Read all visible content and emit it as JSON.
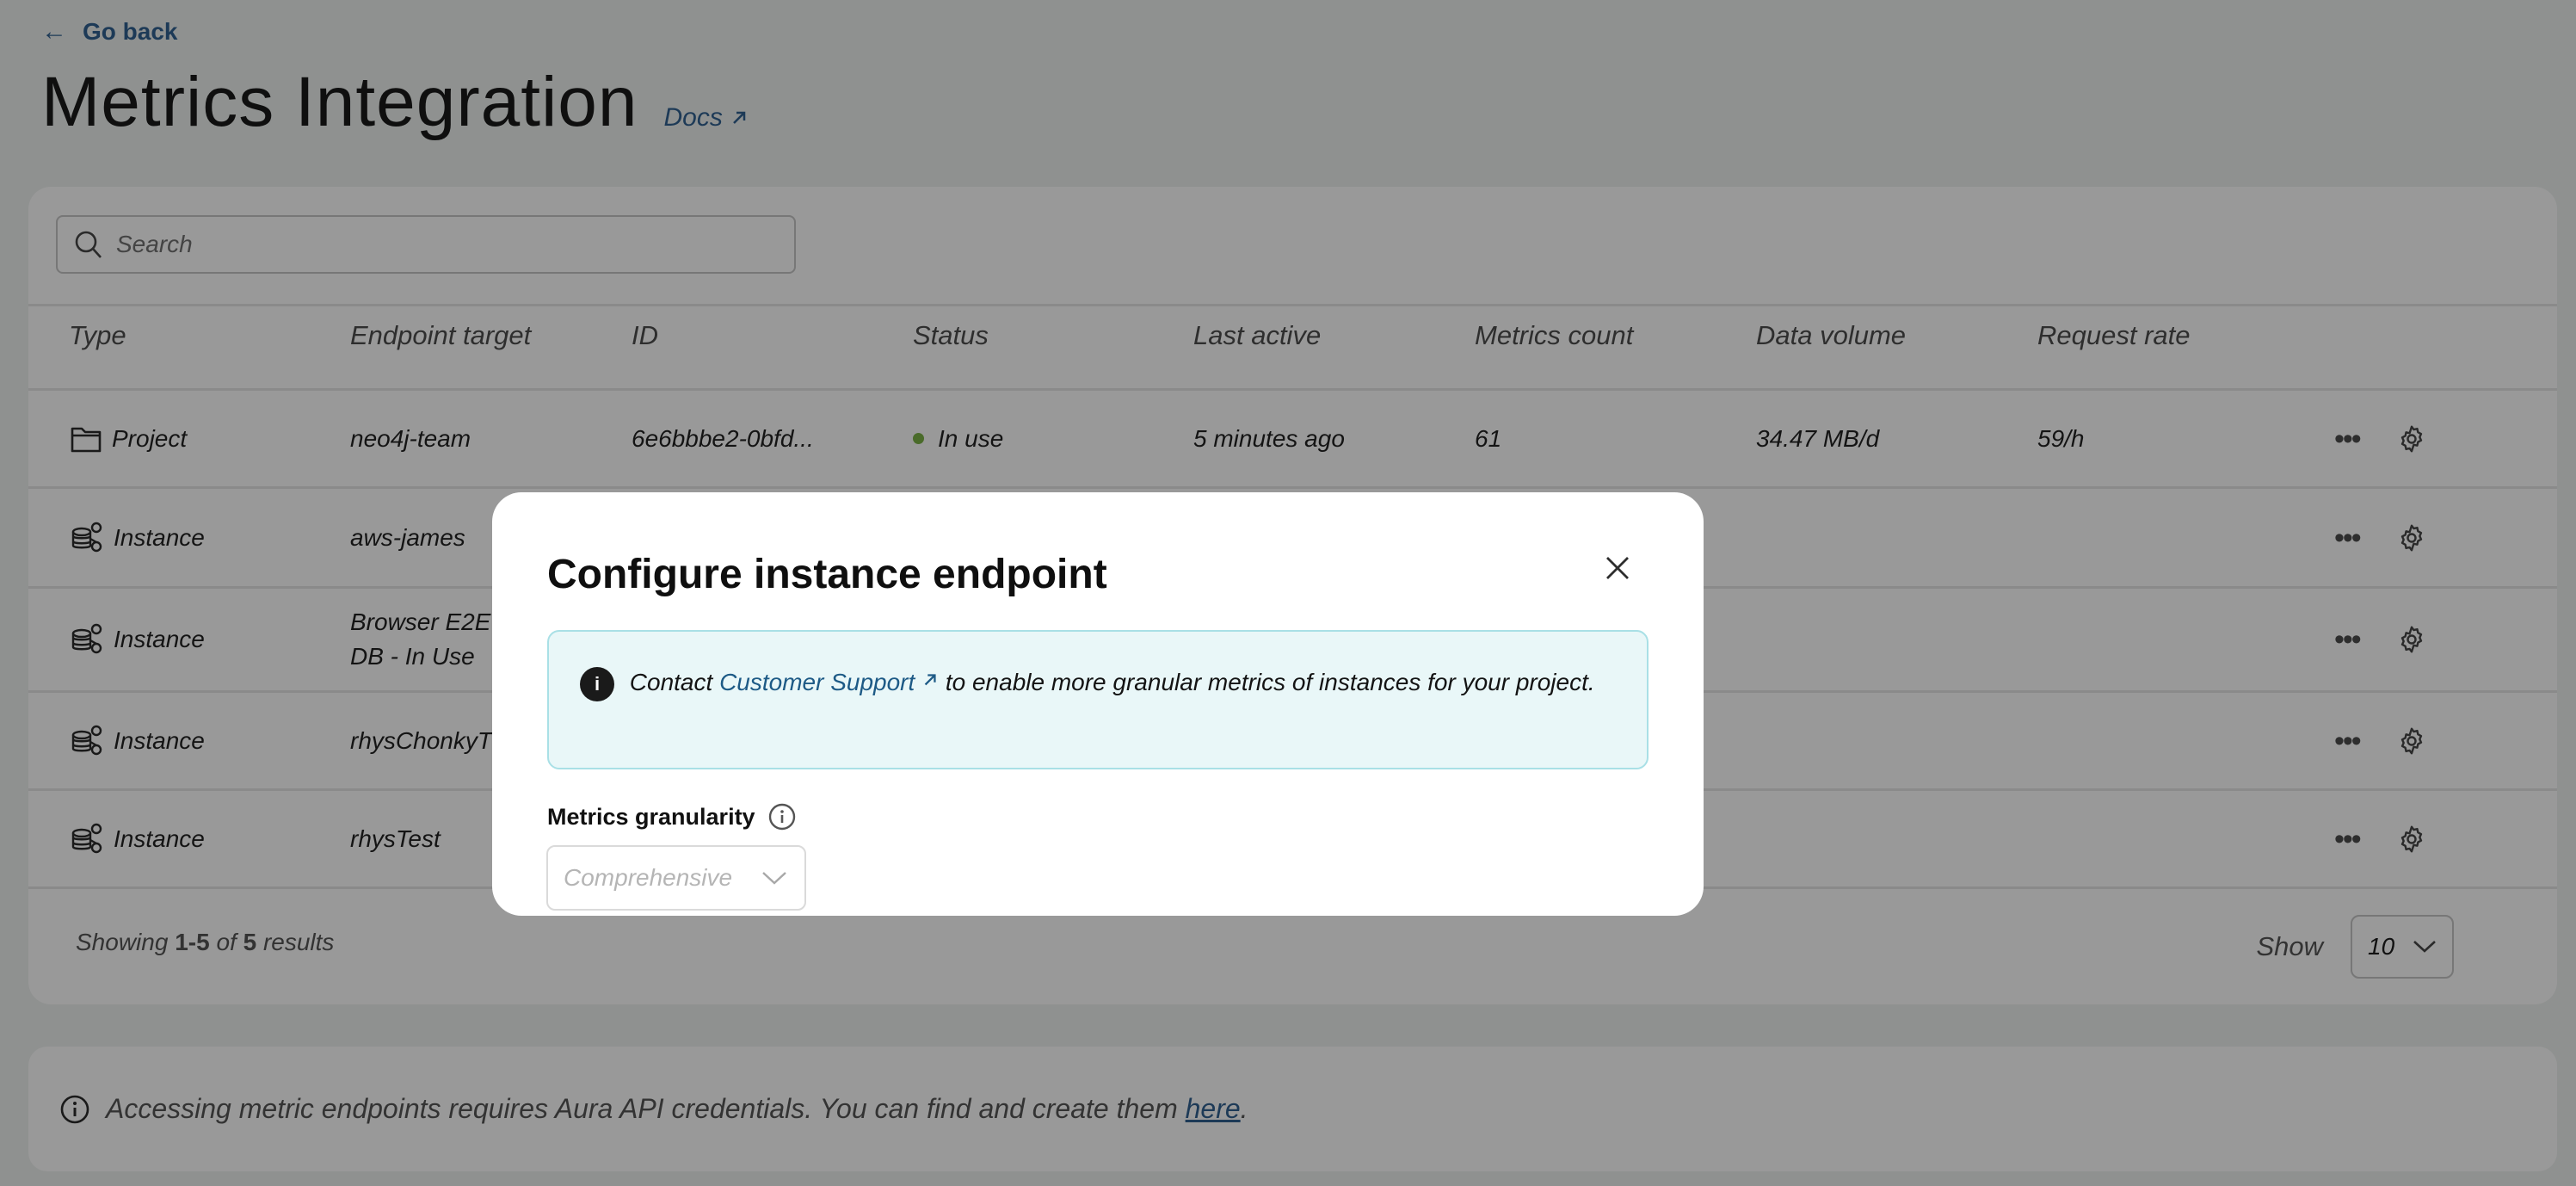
{
  "header": {
    "go_back_label": "Go back",
    "title": "Metrics Integration",
    "docs_label": "Docs"
  },
  "search": {
    "placeholder": "Search",
    "value": ""
  },
  "table": {
    "columns": [
      "Type",
      "Endpoint target",
      "ID",
      "Status",
      "Last active",
      "Metrics count",
      "Data volume",
      "Request rate"
    ],
    "rows": [
      {
        "type": "Project",
        "type_icon": "folder-icon",
        "endpoint_line1": "neo4j-team",
        "endpoint_line2": "",
        "id": "6e6bbbe2-0bfd...",
        "status": "In use",
        "status_color": "#4a6b2a",
        "last_active": "5 minutes ago",
        "metrics_count": "61",
        "data_volume": "34.47 MB/d",
        "request_rate": "59/h"
      },
      {
        "type": "Instance",
        "type_icon": "instances-icon",
        "endpoint_line1": "aws-james",
        "endpoint_line2": "",
        "id": "",
        "status": "",
        "last_active": "",
        "metrics_count": "",
        "data_volume": "",
        "request_rate": ""
      },
      {
        "type": "Instance",
        "type_icon": "instances-icon",
        "endpoint_line1": "Browser E2E",
        "endpoint_line2": "DB - In Use",
        "id": "",
        "status": "",
        "last_active": "",
        "metrics_count": "",
        "data_volume": "",
        "request_rate": ""
      },
      {
        "type": "Instance",
        "type_icon": "instances-icon",
        "endpoint_line1": "rhysChonkyT",
        "endpoint_line2": "",
        "id": "",
        "status": "",
        "last_active": "",
        "metrics_count": "",
        "data_volume": "",
        "request_rate": ""
      },
      {
        "type": "Instance",
        "type_icon": "instances-icon",
        "endpoint_line1": "rhysTest",
        "endpoint_line2": "",
        "id": "",
        "status": "",
        "last_active": "",
        "metrics_count": "",
        "data_volume": "",
        "request_rate": ""
      }
    ]
  },
  "pagination": {
    "showing_prefix": "Showing",
    "range": "1-5",
    "of_label": "of",
    "total": "5",
    "results_label": "results",
    "show_label": "Show",
    "page_size": "10"
  },
  "notice": {
    "text": "Accessing metric endpoints requires Aura API credentials. You can find and create them",
    "link_label": "here",
    "suffix": "."
  },
  "modal": {
    "title": "Configure instance endpoint",
    "info_prefix": "Contact",
    "info_link": "Customer Support",
    "info_suffix": "to enable more granular metrics of instances for your project.",
    "field_label": "Metrics granularity",
    "granularity_value": "Comprehensive",
    "granularity_disabled": true
  },
  "colors": {
    "link": "#1d3a57",
    "status_in_use": "#4a6b2a",
    "info_bg": "#e9f7f8",
    "info_border": "#a9e0e6",
    "overlay": "#8f9190"
  }
}
